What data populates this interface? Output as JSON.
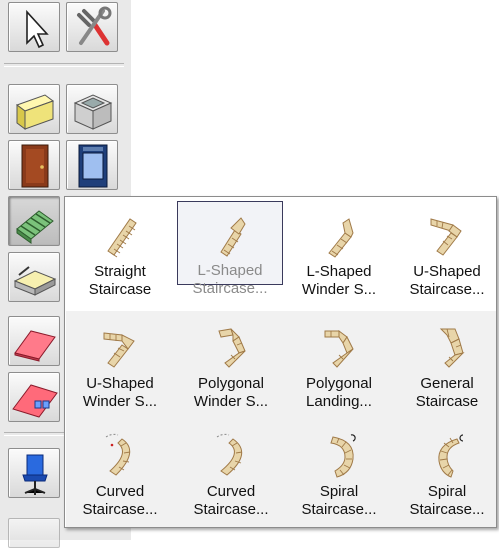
{
  "toolbar": {
    "tools": [
      {
        "name": "selection-arrow-tool"
      },
      {
        "name": "tools-settings-tool"
      },
      {
        "name": "wall-tool"
      },
      {
        "name": "room-tool"
      },
      {
        "name": "door-tool"
      },
      {
        "name": "window-tool"
      },
      {
        "name": "staircase-tool",
        "active": true
      },
      {
        "name": "slab-tool"
      },
      {
        "name": "roof-tool"
      },
      {
        "name": "dormer-roof-tool"
      },
      {
        "name": "chair-furniture-tool"
      }
    ]
  },
  "popup": {
    "colors": {
      "stair_fill": "#e8d5a9",
      "stair_stroke": "#a07a48",
      "selected_border": "#3a3a5c"
    },
    "items": [
      {
        "line1": "Straight",
        "line2": "Staircase"
      },
      {
        "line1": "L-Shaped",
        "line2": "Staircase...",
        "selected": true
      },
      {
        "line1": "L-Shaped",
        "line2": "Winder S..."
      },
      {
        "line1": "U-Shaped",
        "line2": "Staircase..."
      },
      {
        "line1": "U-Shaped",
        "line2": "Winder S..."
      },
      {
        "line1": "Polygonal",
        "line2": "Winder S..."
      },
      {
        "line1": "Polygonal",
        "line2": "Landing..."
      },
      {
        "line1": "General",
        "line2": "Staircase"
      },
      {
        "line1": "Curved",
        "line2": "Staircase..."
      },
      {
        "line1": "Curved",
        "line2": "Staircase..."
      },
      {
        "line1": "Spiral",
        "line2": "Staircase..."
      },
      {
        "line1": "Spiral",
        "line2": "Staircase..."
      }
    ]
  }
}
